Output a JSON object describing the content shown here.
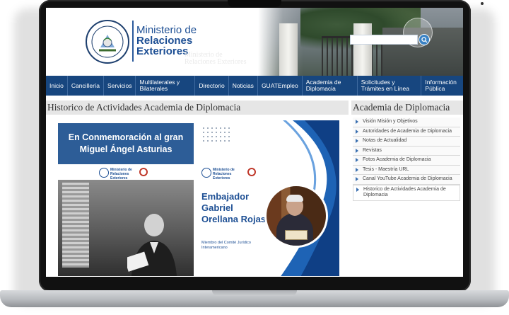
{
  "header": {
    "ministry_line1": "Ministerio de",
    "ministry_line2": "Relaciones",
    "ministry_line3": "Exteriores",
    "wall_text": "Ministerio de Relaciones Exteriores",
    "search_placeholder": ""
  },
  "nav": {
    "items": [
      {
        "label": "Inicio"
      },
      {
        "label": "Cancillería"
      },
      {
        "label": "Servicios"
      },
      {
        "label": "Multilaterales y Bilaterales"
      },
      {
        "label": "Directorio"
      },
      {
        "label": "Noticias"
      },
      {
        "label": "GUATEmpleo"
      },
      {
        "label": "Academia de Diplomacia"
      },
      {
        "label": "Solicitudes y Trámites en Línea"
      },
      {
        "label": "Información Pública"
      }
    ]
  },
  "main": {
    "title": "Historico de Actividades Academia de Diplomacia",
    "banner": {
      "headline": "En Conmemoración al gran Miguel Ángel Asturias",
      "ambassador_name": "Embajador Gabriel Orellana Rojas",
      "ambassador_subtitle": "Miembro del Comité Jurídico Interamericano",
      "mini_logo_text": "Ministerio de Relaciones Exteriores"
    }
  },
  "sidebar": {
    "title": "Academia de Diplomacia",
    "items": [
      {
        "label": "Visión Misión y Objetivos"
      },
      {
        "label": "Autoridades de Academia de Diplomacia"
      },
      {
        "label": "Notas de Actualidad"
      },
      {
        "label": "Revistas"
      },
      {
        "label": "Fotos Academia de Diplomacia"
      },
      {
        "label": "Tesis - Maestría URL"
      },
      {
        "label": "Canal YouTube Academia de Diplomacia"
      },
      {
        "label": "Historico de Actividades Academia de Diplomacia"
      }
    ]
  },
  "colors": {
    "nav_bg": "#17467f",
    "brand_blue": "#1d4f94",
    "banner_blue": "#2d5d97"
  }
}
